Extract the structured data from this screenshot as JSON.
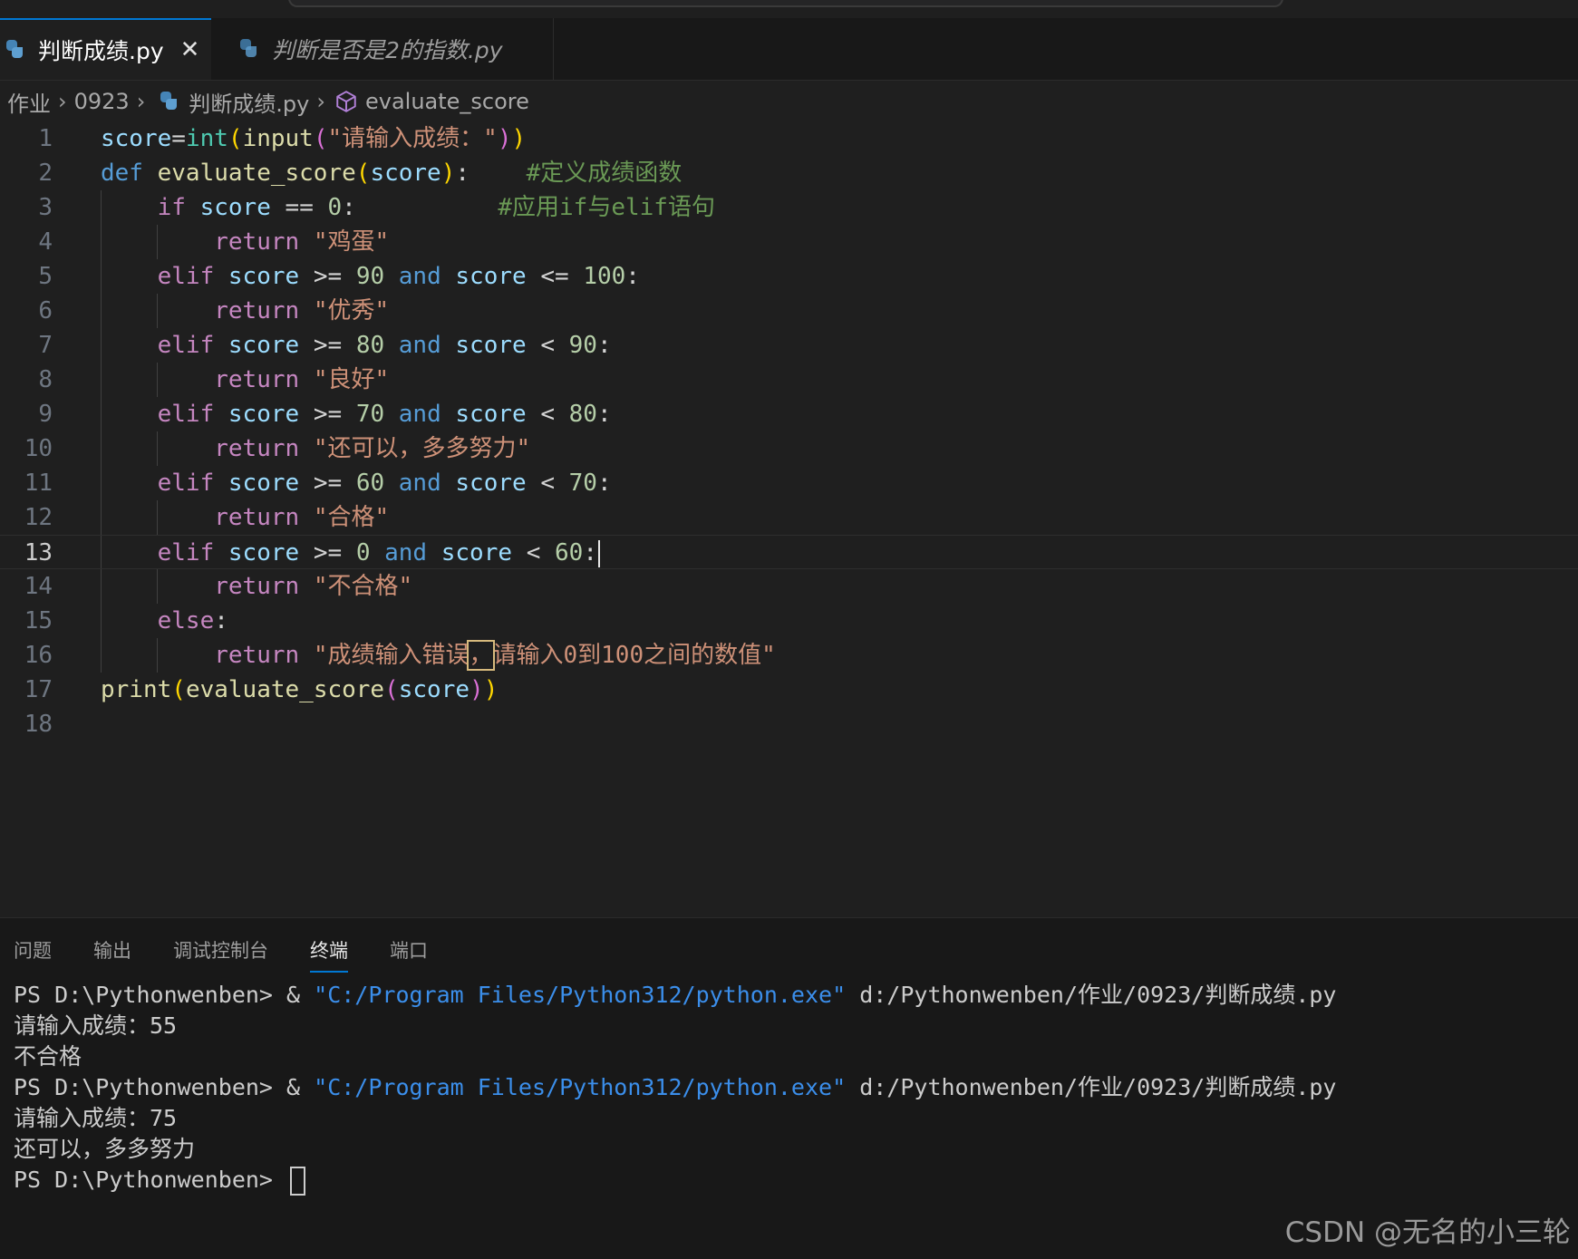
{
  "tabs": [
    {
      "label": "判断成绩.py",
      "active": true,
      "icon": "python-file-icon",
      "close_icon": "✕"
    },
    {
      "label": "判断是否是2的指数.py",
      "active": false,
      "icon": "python-file-icon"
    }
  ],
  "breadcrumb": {
    "folder": "作业",
    "subfolder": "0923",
    "file": "判断成绩.py",
    "symbol": "evaluate_score",
    "separator": "›"
  },
  "editor": {
    "current_line": 13,
    "lines": [
      "score=int(input(\"请输入成绩：\"))",
      "def evaluate_score(score):    #定义成绩函数",
      "    if score == 0:          #应用if与elif语句",
      "        return \"鸡蛋\"",
      "    elif score >= 90 and score <= 100:",
      "        return \"优秀\"",
      "    elif score >= 80 and score < 90:",
      "        return \"良好\"",
      "    elif score >= 70 and score < 80:",
      "        return \"还可以，多多努力\"",
      "    elif score >= 60 and score < 70:",
      "        return \"合格\"",
      "    elif score >= 0 and score < 60:",
      "        return \"不合格\"",
      "    else:",
      "        return \"成绩输入错误，请输入0到100之间的数值\"",
      "print(evaluate_score(score))",
      ""
    ]
  },
  "panel": {
    "tabs": [
      "问题",
      "输出",
      "调试控制台",
      "终端",
      "端口"
    ],
    "active_tab": "终端",
    "terminal": {
      "prompt": "PS D:\\Pythonwenben> ",
      "command_amp": "& ",
      "command_exe": "\"C:/Program Files/Python312/python.exe\"",
      "command_file": " d:/Pythonwenben/作业/0923/判断成绩.py",
      "run1_input": "请输入成绩：55",
      "run1_output": "不合格",
      "run2_input": "请输入成绩：75",
      "run2_output": "还可以，多多努力"
    }
  },
  "watermark": "CSDN @无名的小三轮",
  "colors": {
    "accent": "#0078d4",
    "keyword": "#569cd6",
    "control": "#c586c0",
    "variable": "#9cdcfe",
    "function": "#dcdcaa",
    "string": "#ce9178",
    "number": "#b5cea8",
    "comment": "#6a9955",
    "terminal_string": "#3b8eea"
  }
}
